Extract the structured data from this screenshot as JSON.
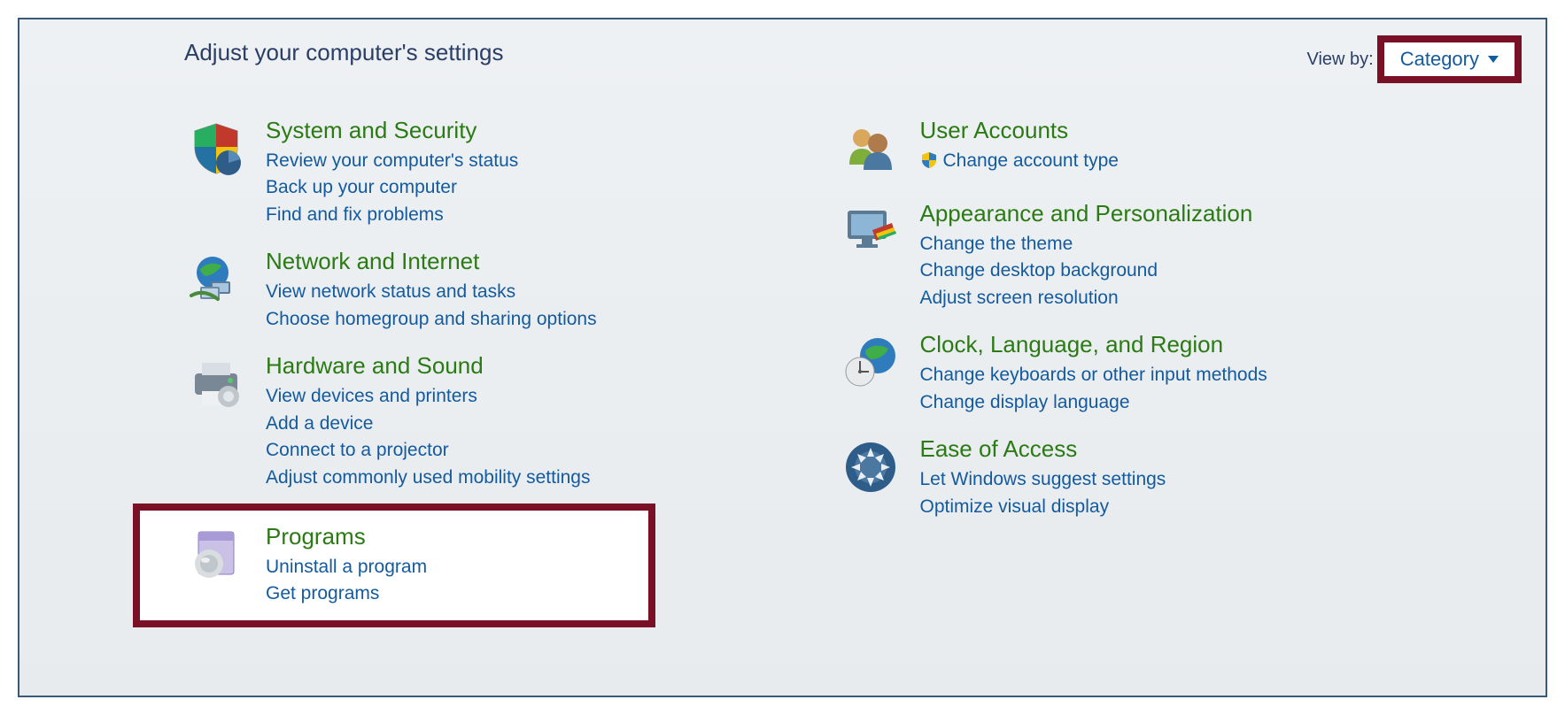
{
  "header": {
    "title": "Adjust your computer's settings"
  },
  "viewby": {
    "label": "View by:",
    "value": "Category"
  },
  "left": [
    {
      "title": "System and Security",
      "links": [
        "Review your computer's status",
        "Back up your computer",
        "Find and fix problems"
      ]
    },
    {
      "title": "Network and Internet",
      "links": [
        "View network status and tasks",
        "Choose homegroup and sharing options"
      ]
    },
    {
      "title": "Hardware and Sound",
      "links": [
        "View devices and printers",
        "Add a device",
        "Connect to a projector",
        "Adjust commonly used mobility settings"
      ]
    },
    {
      "title": "Programs",
      "links": [
        "Uninstall a program",
        "Get programs"
      ]
    }
  ],
  "right": [
    {
      "title": "User Accounts",
      "links": [
        "Change account type"
      ],
      "uac": [
        true
      ]
    },
    {
      "title": "Appearance and Personalization",
      "links": [
        "Change the theme",
        "Change desktop background",
        "Adjust screen resolution"
      ]
    },
    {
      "title": "Clock, Language, and Region",
      "links": [
        "Change keyboards or other input methods",
        "Change display language"
      ]
    },
    {
      "title": "Ease of Access",
      "links": [
        "Let Windows suggest settings",
        "Optimize visual display"
      ]
    }
  ]
}
